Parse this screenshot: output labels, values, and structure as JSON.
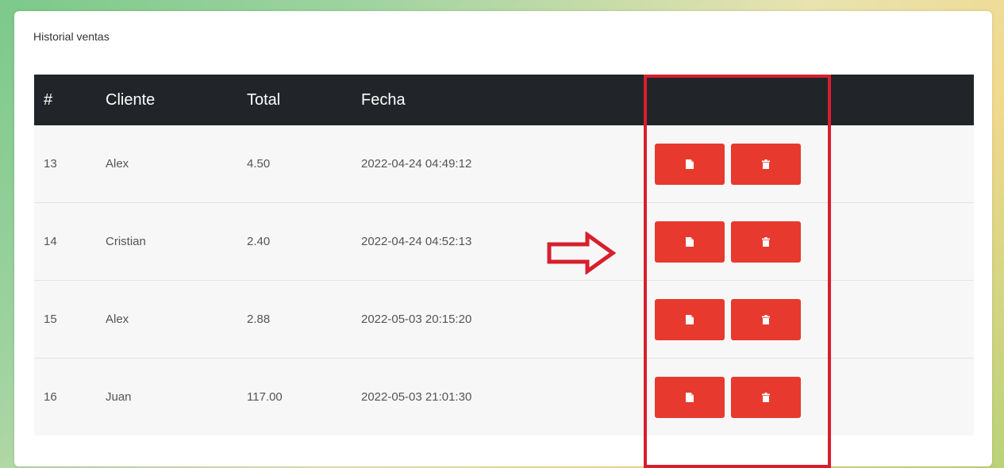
{
  "card": {
    "title": "Historial ventas"
  },
  "table": {
    "headers": {
      "num": "#",
      "client": "Cliente",
      "total": "Total",
      "date": "Fecha"
    },
    "rows": [
      {
        "num": "13",
        "client": "Alex",
        "total": "4.50",
        "date": "2022-04-24 04:49:12"
      },
      {
        "num": "14",
        "client": "Cristian",
        "total": "2.40",
        "date": "2022-04-24 04:52:13"
      },
      {
        "num": "15",
        "client": "Alex",
        "total": "2.88",
        "date": "2022-05-03 20:15:20"
      },
      {
        "num": "16",
        "client": "Juan",
        "total": "117.00",
        "date": "2022-05-03 21:01:30"
      }
    ]
  },
  "icons": {
    "pdf": "file-icon",
    "delete": "trash-icon"
  },
  "colors": {
    "header_bg": "#212529",
    "button": "#e8392e",
    "highlight": "#d71f2e"
  }
}
